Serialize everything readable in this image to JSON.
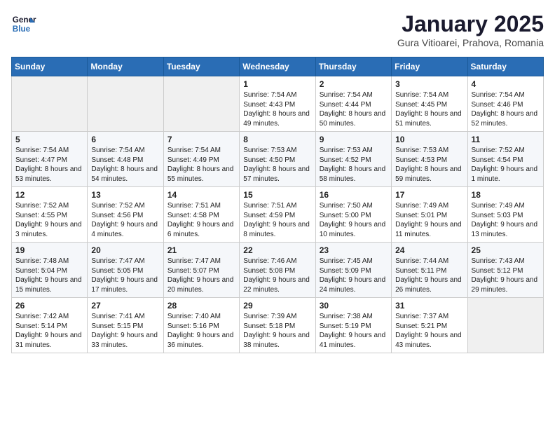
{
  "header": {
    "logo_line1": "General",
    "logo_line2": "Blue",
    "title": "January 2025",
    "location": "Gura Vitioarei, Prahova, Romania"
  },
  "weekdays": [
    "Sunday",
    "Monday",
    "Tuesday",
    "Wednesday",
    "Thursday",
    "Friday",
    "Saturday"
  ],
  "weeks": [
    [
      {
        "day": "",
        "info": ""
      },
      {
        "day": "",
        "info": ""
      },
      {
        "day": "",
        "info": ""
      },
      {
        "day": "1",
        "info": "Sunrise: 7:54 AM\nSunset: 4:43 PM\nDaylight: 8 hours\nand 49 minutes."
      },
      {
        "day": "2",
        "info": "Sunrise: 7:54 AM\nSunset: 4:44 PM\nDaylight: 8 hours\nand 50 minutes."
      },
      {
        "day": "3",
        "info": "Sunrise: 7:54 AM\nSunset: 4:45 PM\nDaylight: 8 hours\nand 51 minutes."
      },
      {
        "day": "4",
        "info": "Sunrise: 7:54 AM\nSunset: 4:46 PM\nDaylight: 8 hours\nand 52 minutes."
      }
    ],
    [
      {
        "day": "5",
        "info": "Sunrise: 7:54 AM\nSunset: 4:47 PM\nDaylight: 8 hours\nand 53 minutes."
      },
      {
        "day": "6",
        "info": "Sunrise: 7:54 AM\nSunset: 4:48 PM\nDaylight: 8 hours\nand 54 minutes."
      },
      {
        "day": "7",
        "info": "Sunrise: 7:54 AM\nSunset: 4:49 PM\nDaylight: 8 hours\nand 55 minutes."
      },
      {
        "day": "8",
        "info": "Sunrise: 7:53 AM\nSunset: 4:50 PM\nDaylight: 8 hours\nand 57 minutes."
      },
      {
        "day": "9",
        "info": "Sunrise: 7:53 AM\nSunset: 4:52 PM\nDaylight: 8 hours\nand 58 minutes."
      },
      {
        "day": "10",
        "info": "Sunrise: 7:53 AM\nSunset: 4:53 PM\nDaylight: 8 hours\nand 59 minutes."
      },
      {
        "day": "11",
        "info": "Sunrise: 7:52 AM\nSunset: 4:54 PM\nDaylight: 9 hours\nand 1 minute."
      }
    ],
    [
      {
        "day": "12",
        "info": "Sunrise: 7:52 AM\nSunset: 4:55 PM\nDaylight: 9 hours\nand 3 minutes."
      },
      {
        "day": "13",
        "info": "Sunrise: 7:52 AM\nSunset: 4:56 PM\nDaylight: 9 hours\nand 4 minutes."
      },
      {
        "day": "14",
        "info": "Sunrise: 7:51 AM\nSunset: 4:58 PM\nDaylight: 9 hours\nand 6 minutes."
      },
      {
        "day": "15",
        "info": "Sunrise: 7:51 AM\nSunset: 4:59 PM\nDaylight: 9 hours\nand 8 minutes."
      },
      {
        "day": "16",
        "info": "Sunrise: 7:50 AM\nSunset: 5:00 PM\nDaylight: 9 hours\nand 10 minutes."
      },
      {
        "day": "17",
        "info": "Sunrise: 7:49 AM\nSunset: 5:01 PM\nDaylight: 9 hours\nand 11 minutes."
      },
      {
        "day": "18",
        "info": "Sunrise: 7:49 AM\nSunset: 5:03 PM\nDaylight: 9 hours\nand 13 minutes."
      }
    ],
    [
      {
        "day": "19",
        "info": "Sunrise: 7:48 AM\nSunset: 5:04 PM\nDaylight: 9 hours\nand 15 minutes."
      },
      {
        "day": "20",
        "info": "Sunrise: 7:47 AM\nSunset: 5:05 PM\nDaylight: 9 hours\nand 17 minutes."
      },
      {
        "day": "21",
        "info": "Sunrise: 7:47 AM\nSunset: 5:07 PM\nDaylight: 9 hours\nand 20 minutes."
      },
      {
        "day": "22",
        "info": "Sunrise: 7:46 AM\nSunset: 5:08 PM\nDaylight: 9 hours\nand 22 minutes."
      },
      {
        "day": "23",
        "info": "Sunrise: 7:45 AM\nSunset: 5:09 PM\nDaylight: 9 hours\nand 24 minutes."
      },
      {
        "day": "24",
        "info": "Sunrise: 7:44 AM\nSunset: 5:11 PM\nDaylight: 9 hours\nand 26 minutes."
      },
      {
        "day": "25",
        "info": "Sunrise: 7:43 AM\nSunset: 5:12 PM\nDaylight: 9 hours\nand 29 minutes."
      }
    ],
    [
      {
        "day": "26",
        "info": "Sunrise: 7:42 AM\nSunset: 5:14 PM\nDaylight: 9 hours\nand 31 minutes."
      },
      {
        "day": "27",
        "info": "Sunrise: 7:41 AM\nSunset: 5:15 PM\nDaylight: 9 hours\nand 33 minutes."
      },
      {
        "day": "28",
        "info": "Sunrise: 7:40 AM\nSunset: 5:16 PM\nDaylight: 9 hours\nand 36 minutes."
      },
      {
        "day": "29",
        "info": "Sunrise: 7:39 AM\nSunset: 5:18 PM\nDaylight: 9 hours\nand 38 minutes."
      },
      {
        "day": "30",
        "info": "Sunrise: 7:38 AM\nSunset: 5:19 PM\nDaylight: 9 hours\nand 41 minutes."
      },
      {
        "day": "31",
        "info": "Sunrise: 7:37 AM\nSunset: 5:21 PM\nDaylight: 9 hours\nand 43 minutes."
      },
      {
        "day": "",
        "info": ""
      }
    ]
  ]
}
